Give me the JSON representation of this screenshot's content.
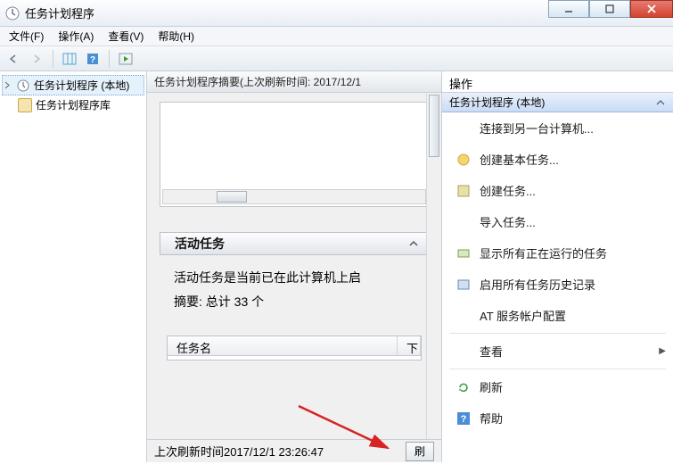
{
  "window": {
    "title": "任务计划程序"
  },
  "menus": {
    "file": "文件(F)",
    "action": "操作(A)",
    "view": "查看(V)",
    "help": "帮助(H)"
  },
  "tree": {
    "root": "任务计划程序 (本地)",
    "child": "任务计划程序库"
  },
  "center": {
    "header": "任务计划程序摘要(上次刷新时间: 2017/12/1",
    "active_tasks_header": "活动任务",
    "active_desc": "活动任务是当前已在此计算机上启",
    "summary": "摘要: 总计 33 个",
    "col_name": "任务名",
    "col_next": "下",
    "footer": "上次刷新时间2017/12/1 23:26:47",
    "refresh_btn": "刷"
  },
  "actions_title": "操作",
  "actions_section": "任务计划程序 (本地)",
  "actions": {
    "connect": "连接到另一台计算机...",
    "basic": "创建基本任务...",
    "create": "创建任务...",
    "import": "导入任务...",
    "running": "显示所有正在运行的任务",
    "history": "启用所有任务历史记录",
    "atservice": "AT 服务帐户配置",
    "view": "查看",
    "refresh": "刷新",
    "help": "帮助"
  }
}
